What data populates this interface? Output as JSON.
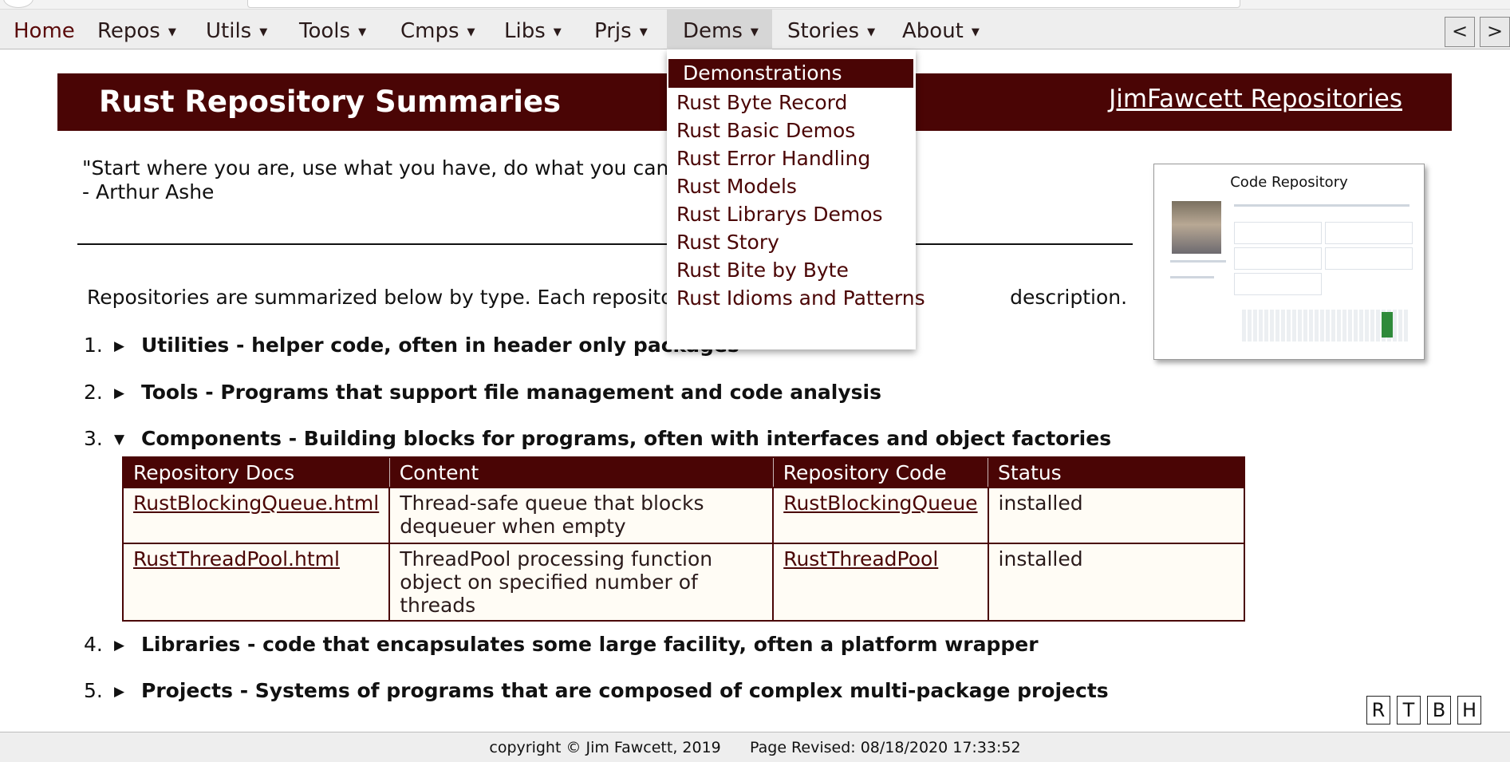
{
  "menu": {
    "items": [
      {
        "label": "Home",
        "caret": ""
      },
      {
        "label": "Repos",
        "caret": "▼"
      },
      {
        "label": "Utils",
        "caret": "▼"
      },
      {
        "label": "Tools",
        "caret": "▼"
      },
      {
        "label": "Cmps",
        "caret": "▼"
      },
      {
        "label": "Libs",
        "caret": "▼"
      },
      {
        "label": "Prjs",
        "caret": "▼"
      },
      {
        "label": "Dems",
        "caret": "▼"
      },
      {
        "label": "Stories",
        "caret": "▼"
      },
      {
        "label": "About",
        "caret": "▼"
      }
    ],
    "prev_label": "<",
    "next_label": ">"
  },
  "dropdown": {
    "header": "Demonstrations",
    "items": [
      "Rust Byte Record",
      "Rust Basic Demos",
      "Rust Error Handling",
      "Rust Models",
      "Rust Librarys Demos",
      "Rust Story",
      "Rust Bite by Byte",
      "Rust Idioms and Patterns"
    ]
  },
  "banner": {
    "title": "Rust Repository Summaries",
    "link": "JimFawcett Repositories"
  },
  "quote": {
    "text": "\"Start where you are, use what you have, do what you can.\"",
    "author": "- Arthur Ashe"
  },
  "intro_left": "Repositories are summarized below by type. Each repository summ",
  "intro_right": "description.",
  "sections": [
    {
      "num": "1.",
      "toggle": "▶",
      "text": "Utilities - helper code, often in header only packages"
    },
    {
      "num": "2.",
      "toggle": "▶",
      "text": "Tools - Programs that support file management and code analysis"
    },
    {
      "num": "3.",
      "toggle": "▼",
      "text": "Components - Building blocks for programs, often with interfaces and object factories"
    },
    {
      "num": "4.",
      "toggle": "▶",
      "text": "Libraries - code that encapsulates some large facility, often a platform wrapper"
    },
    {
      "num": "5.",
      "toggle": "▶",
      "text": "Projects - Systems of programs that are composed of complex multi-package projects"
    }
  ],
  "table": {
    "headers": [
      "Repository Docs",
      "Content",
      "Repository Code",
      "Status"
    ],
    "rows": [
      {
        "docs": "RustBlockingQueue.html",
        "content": "Thread-safe queue that blocks dequeuer when empty",
        "code": "RustBlockingQueue",
        "status": "installed"
      },
      {
        "docs": "RustThreadPool.html",
        "content": "ThreadPool processing function object on specified number of threads",
        "code": "RustThreadPool",
        "status": "installed"
      }
    ]
  },
  "card": {
    "title": "Code Repository"
  },
  "side_buttons": [
    "R",
    "T",
    "B",
    "H"
  ],
  "footer": {
    "copyright": "copyright © Jim Fawcett, 2019",
    "revised": "Page Revised: 08/18/2020 17:33:52"
  }
}
